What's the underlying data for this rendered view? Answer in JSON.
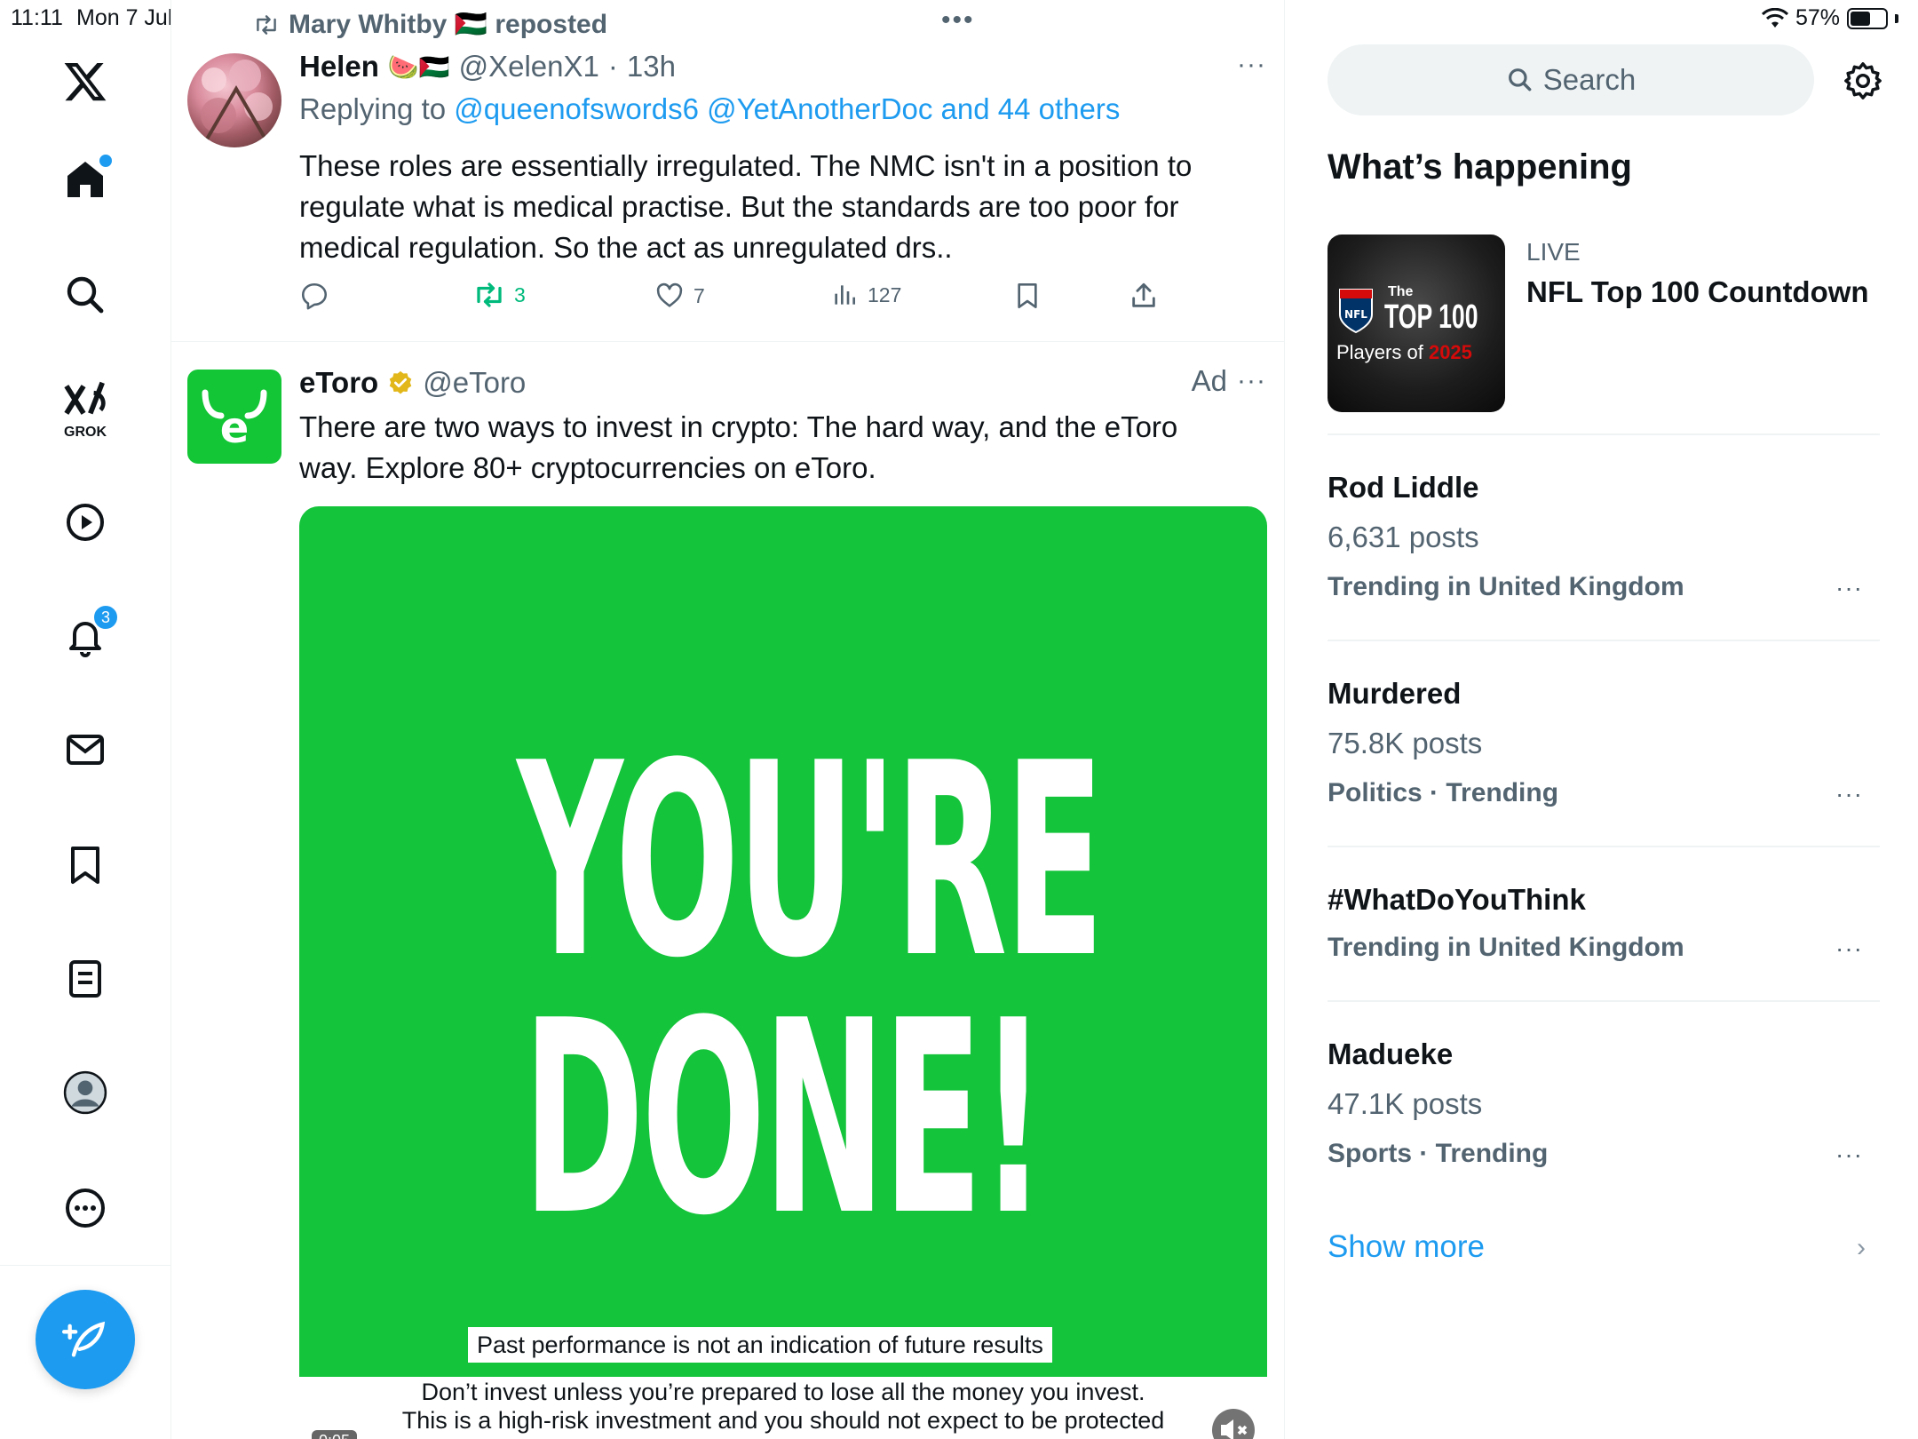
{
  "status": {
    "time": "11:11",
    "date": "Mon 7 Jul",
    "battery": "57%",
    "battery_level": 0.57
  },
  "nav": {
    "grok_label": "GROK",
    "notifications_badge": "3"
  },
  "tweet1": {
    "repost_text": "Mary Whitby 🇵🇸 reposted",
    "name": "Helen",
    "name_emoji": "🍉🇵🇸",
    "handle": "@XelenX1",
    "time_sep": "·",
    "time": "13h",
    "replying_prefix": "Replying to",
    "replying_links": "@queenofswords6 @YetAnotherDoc and 44 others",
    "text": "These roles are essentially irregulated. The NMC isn't in a position to regulate what is medical practise. But the standards are too poor for medical regulation. So the act as unregulated drs..",
    "reposts": "3",
    "likes": "7",
    "views": "127"
  },
  "tweet2": {
    "name": "eToro",
    "handle": "@eToro",
    "ad_label": "Ad",
    "text": "There are two ways to invest in crypto: The hard way, and the eToro way. Explore 80+ cryptocurrencies on eToro.",
    "media": {
      "line1": "YOU'RE",
      "line2": "DONE!",
      "disclaimer": "Past performance is not an indication of future results",
      "warning1": "Don’t invest unless you’re prepared to lose all the money you invest.",
      "warning2": "This is a high-risk investment and you should not expect to be protected",
      "video_time": "0:05"
    }
  },
  "right": {
    "search_placeholder": "Search",
    "section_title": "What’s happening",
    "live": {
      "label": "LIVE",
      "title": "NFL Top 100 Countdown",
      "thumb_line1": "The",
      "thumb_line2": "TOP 100",
      "thumb_line3": "Players of",
      "thumb_year": "2025"
    },
    "trends": [
      {
        "name": "Rod Liddle",
        "count": "6,631 posts",
        "meta": "Trending in United Kingdom"
      },
      {
        "name": "Murdered",
        "count": "75.8K posts",
        "meta": "Politics · Trending"
      },
      {
        "name": "#WhatDoYouThink",
        "count": "",
        "meta": "Trending in United Kingdom"
      },
      {
        "name": "Madueke",
        "count": "47.1K posts",
        "meta": "Sports · Trending"
      }
    ],
    "show_more": "Show more"
  },
  "colors": {
    "accent": "#1d9bf0",
    "repost_green": "#00ba7c",
    "etoro_green": "#13c636",
    "text_secondary": "#536471"
  }
}
